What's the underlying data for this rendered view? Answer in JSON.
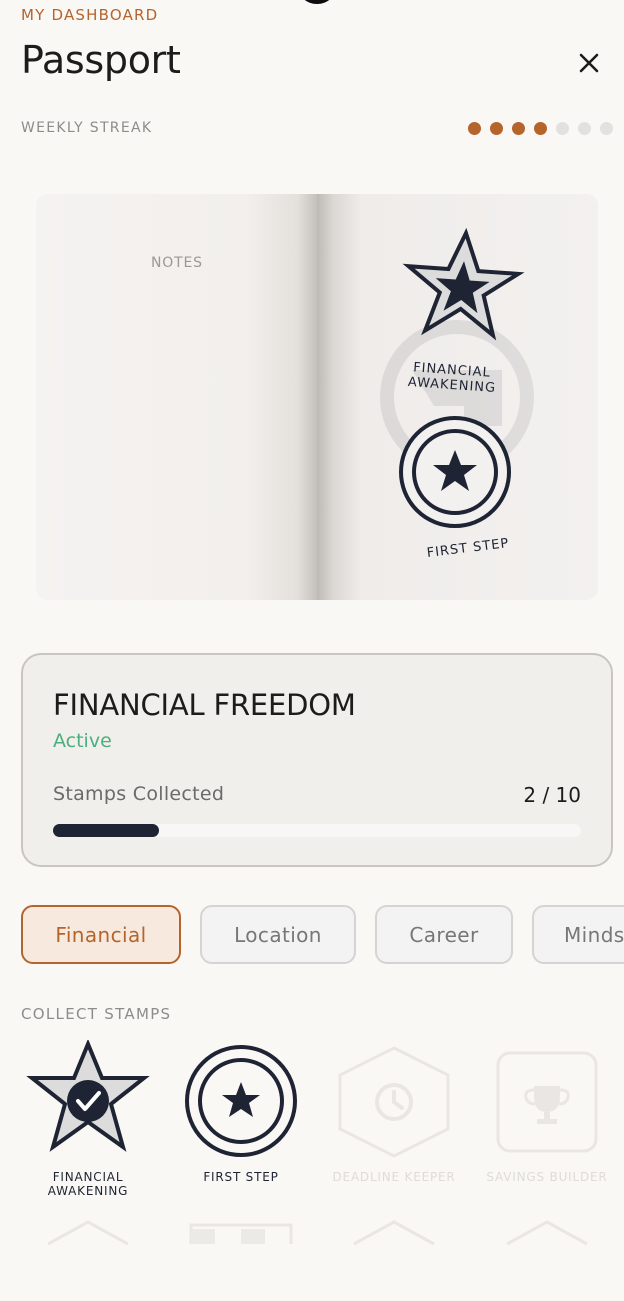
{
  "header": {
    "eyebrow": "MY DASHBOARD",
    "title": "Passport",
    "close_icon": "close-icon"
  },
  "streak": {
    "label": "WEEKLY STREAK",
    "total_days": 7,
    "completed_days": 4,
    "active_color": "#b5642c",
    "inactive_color": "#e3e1df"
  },
  "passport": {
    "notes_label": "NOTES",
    "stamps": [
      {
        "name": "FINANCIAL AWAKENING",
        "line1": "FINANCIAL",
        "line2": "AWAKENING",
        "icon": "star-icon"
      },
      {
        "name": "FIRST STEP",
        "icon": "circle-star-icon"
      }
    ]
  },
  "program": {
    "title": "FINANCIAL FREEDOM",
    "status": "Active",
    "stamps_label": "Stamps Collected",
    "collected": 2,
    "total": 10,
    "count_text": "2 / 10"
  },
  "tabs": [
    {
      "label": "Financial",
      "active": true
    },
    {
      "label": "Location",
      "active": false
    },
    {
      "label": "Career",
      "active": false
    },
    {
      "label": "Minds",
      "active": false
    }
  ],
  "collect": {
    "label": "COLLECT STAMPS",
    "items": [
      {
        "line1": "FINANCIAL",
        "line2": "AWAKENING",
        "collected": true,
        "icon": "star-check-icon"
      },
      {
        "line1": "FIRST STEP",
        "line2": "",
        "collected": true,
        "icon": "circle-star-icon"
      },
      {
        "line1": "DEADLINE KEEPER",
        "line2": "",
        "collected": false,
        "icon": "clock-hexagon-icon"
      },
      {
        "line1": "SAVINGS BUILDER",
        "line2": "",
        "collected": false,
        "icon": "trophy-icon"
      }
    ]
  },
  "colors": {
    "accent": "#b5642c",
    "navy": "#1e2433",
    "active_green": "#4caf7d",
    "locked": "#e9e6e3"
  }
}
